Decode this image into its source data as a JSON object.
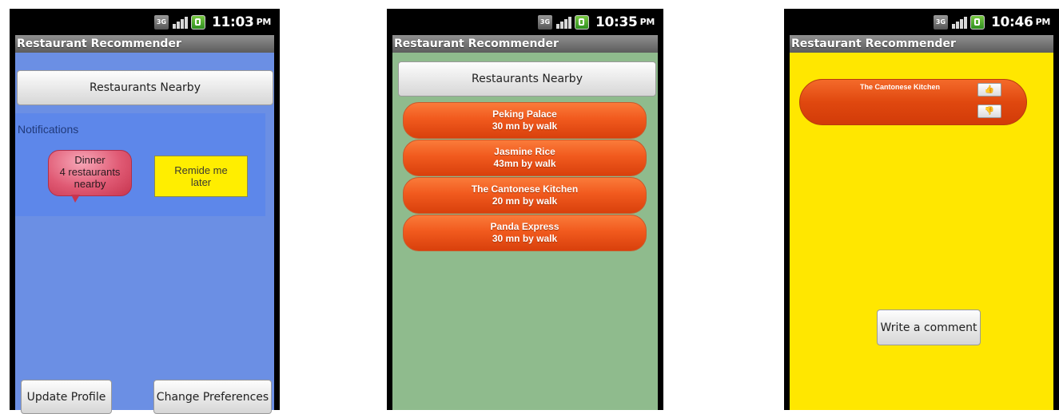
{
  "screens": [
    {
      "status_time": "11:03",
      "status_ampm": "PM",
      "title": "Restaurant Recommender",
      "nearby_button": "Restaurants Nearby",
      "notifications_label": "Notifications",
      "bubble_lines": [
        "Dinner",
        "4 restaurants",
        "nearby"
      ],
      "remind_lines": [
        "Remide me",
        "later"
      ],
      "update_button": "Update Profile",
      "prefs_button": "Change Preferences"
    },
    {
      "status_time": "10:35",
      "status_ampm": "PM",
      "title": "Restaurant Recommender",
      "nearby_button": "Restaurants Nearby",
      "restaurants": [
        {
          "name": "Peking Palace",
          "distance": "30 mn by walk"
        },
        {
          "name": "Jasmine Rice",
          "distance": "43mn by walk"
        },
        {
          "name": "The Cantonese Kitchen",
          "distance": "20 mn by walk"
        },
        {
          "name": "Panda Express",
          "distance": "30 mn by walk"
        }
      ]
    },
    {
      "status_time": "10:46",
      "status_ampm": "PM",
      "title": "Restaurant Recommender",
      "restaurant_name": "The Cantonese Kitchen",
      "comment_button": "Write a comment"
    }
  ],
  "status_icons": [
    "3g-icon",
    "signal-icon",
    "battery-icon"
  ],
  "colors": {
    "screen1_bg": "#6b8fe4",
    "screen2_bg": "#8fbb8d",
    "screen3_bg": "#ffe700",
    "restaurant_button": "#e8501a"
  }
}
